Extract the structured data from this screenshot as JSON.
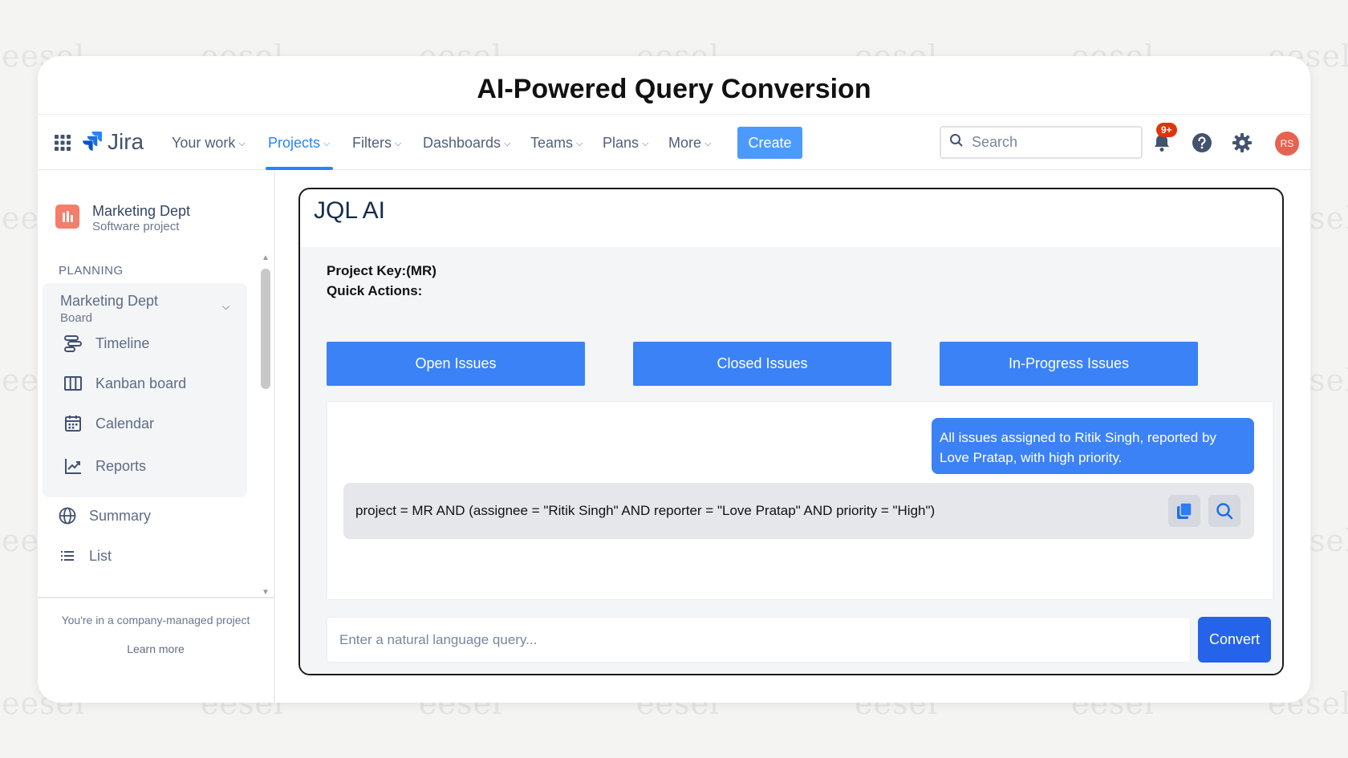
{
  "watermark": "eesel",
  "header": {
    "title": "AI-Powered Query Conversion"
  },
  "topnav": {
    "logo_text": "Jira",
    "items": [
      {
        "label": "Your work",
        "active": false
      },
      {
        "label": "Projects",
        "active": true
      },
      {
        "label": "Filters",
        "active": false
      },
      {
        "label": "Dashboards",
        "active": false
      },
      {
        "label": "Teams",
        "active": false
      },
      {
        "label": "Plans",
        "active": false
      },
      {
        "label": "More",
        "active": false
      }
    ],
    "create_label": "Create",
    "search_placeholder": "Search",
    "notification_badge": "9+",
    "avatar_initials": "RS",
    "accent_color": "#2684ff"
  },
  "sidebar": {
    "project_name": "Marketing Dept",
    "project_type": "Software project",
    "section": "PLANNING",
    "board_name": "Marketing Dept",
    "board_sub": "Board",
    "board_items": [
      {
        "label": "Timeline",
        "icon": "timeline-icon"
      },
      {
        "label": "Kanban board",
        "icon": "kanban-icon"
      },
      {
        "label": "Calendar",
        "icon": "calendar-icon"
      },
      {
        "label": "Reports",
        "icon": "reports-icon"
      }
    ],
    "items": [
      {
        "label": "Summary",
        "icon": "globe-icon"
      },
      {
        "label": "List",
        "icon": "list-icon"
      }
    ],
    "footer_text": "You're in a company-managed project",
    "learn_more": "Learn more"
  },
  "jql": {
    "title": "JQL AI",
    "project_key": "Project Key:(MR)",
    "quick_actions_label": "Quick Actions:",
    "quick_actions": [
      "Open Issues",
      "Closed Issues",
      "In-Progress Issues"
    ],
    "user_message": "All issues assigned to Ritik Singh, reported by Love Pratap, with high priority.",
    "result_query": "project = MR AND (assignee = \"Ritik Singh\" AND reporter = \"Love Pratap\" AND priority = \"High\")",
    "input_placeholder": "Enter a natural language query...",
    "convert_label": "Convert",
    "button_color": "#3b82f6"
  }
}
